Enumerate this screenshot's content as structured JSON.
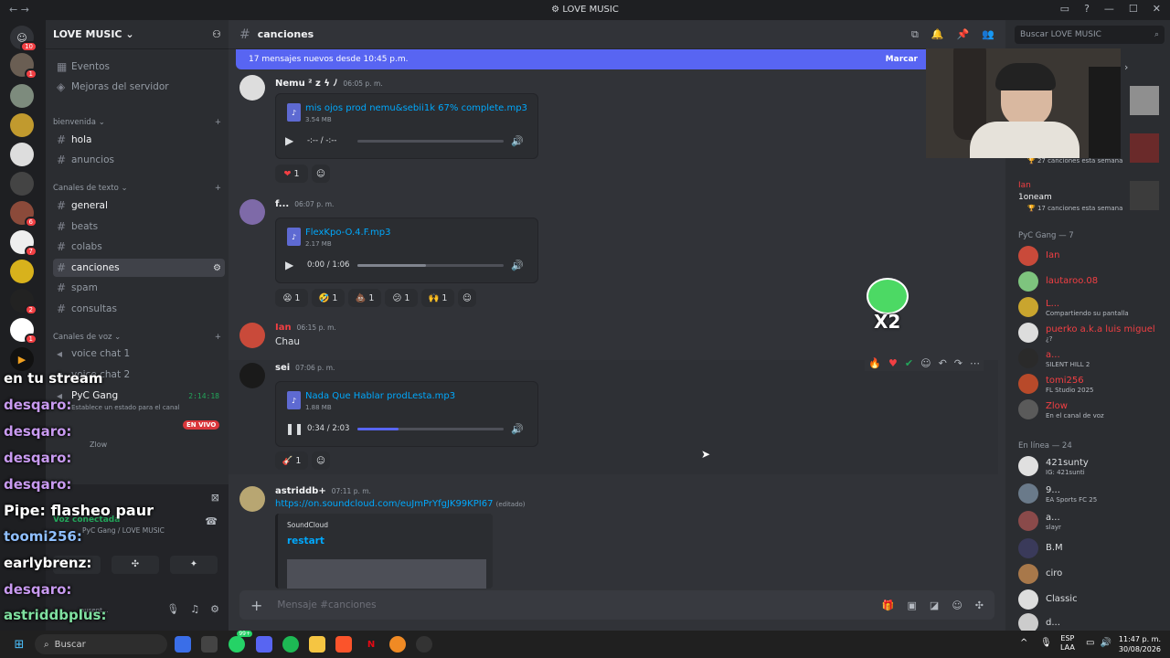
{
  "titlebar": {
    "title": "LOVE MUSIC",
    "nav": "←  →",
    "controls": [
      "▭",
      "?",
      "—",
      "☐",
      "✕"
    ]
  },
  "servers": {
    "home_badge": "10",
    "items": [
      {
        "badge": "1"
      },
      {
        "badge": ""
      },
      {
        "badge": ""
      },
      {
        "badge": ""
      },
      {
        "badge": ""
      },
      {
        "badge": "6"
      },
      {
        "badge": "7"
      },
      {
        "badge": ""
      },
      {
        "badge": "2"
      },
      {
        "badge": "1"
      },
      {
        "badge": ""
      },
      {
        "badge": "1"
      }
    ]
  },
  "guild": {
    "name": "LOVE MUSIC"
  },
  "sidebar": {
    "top_items": [
      "Eventos",
      "Mejoras del servidor"
    ],
    "cat_bienvenida": "bienvenida",
    "ch_hola": "hola",
    "ch_anuncios": "anuncios",
    "cat_text": "Canales de texto",
    "text_channels": [
      "general",
      "beats",
      "colabs",
      "canciones",
      "spam",
      "consultas"
    ],
    "cat_voice": "Canales de voz",
    "voice_channels": [
      "voice chat 1",
      "voice chat 2"
    ],
    "pyc_gang": "PyC Gang",
    "pyc_time": "2:14:18",
    "pyc_status": "Establece un estado para el canal",
    "live_badge": "EN VIVO",
    "zlow": "Zlow",
    "voice_connected": "Voz conectada",
    "voice_location": "PyC Gang / LOVE MUSIC",
    "user_status": "ausent..."
  },
  "overlay_chat": [
    "en tu stream",
    "desqaro:",
    "desqaro:",
    "desqaro:",
    "desqaro:",
    "Pipe: flasheo paur",
    "toomi256:",
    "earlybrenz:",
    "desqaro:",
    "astriddbplus:"
  ],
  "channel": {
    "name": "canciones",
    "search_placeholder": "Buscar LOVE MUSIC"
  },
  "newbar": {
    "text": "17 mensajes nuevos desde 10:45 p.m.",
    "action": "Marcar"
  },
  "messages": [
    {
      "author": "Nemu ² z ϟ ﾉ",
      "time": "06:05 p. m.",
      "file": "mis ojos prod nemu&sebii1k 67% complete.mp3",
      "size": "3.54 MB",
      "player_time": "-:-- / -:--",
      "progress": 0,
      "reactions": [
        {
          "emoji": "❤",
          "count": "1"
        }
      ]
    },
    {
      "author": "f...",
      "time": "06:07 p. m.",
      "file": "FlexKpo-O.4.F.mp3",
      "size": "2.17 MB",
      "player_time": "0:00 / 1:06",
      "progress": 0.47,
      "reactions": [
        {
          "emoji": "😫",
          "count": "1"
        },
        {
          "emoji": "🤣",
          "count": "1"
        },
        {
          "emoji": "💩",
          "count": "1"
        },
        {
          "emoji": "😕",
          "count": "1"
        },
        {
          "emoji": "🙌",
          "count": "1"
        }
      ]
    },
    {
      "author": "Ian",
      "time": "06:15 p. m.",
      "text": "Chau"
    },
    {
      "author": "sei",
      "time": "07:06 p. m.",
      "file": "Nada Que Hablar prodLesta.mp3",
      "size": "1.88 MB",
      "player_time": "0:34 / 2:03",
      "progress": 0.28,
      "reactions": [
        {
          "emoji": "🎸",
          "count": "1"
        }
      ]
    },
    {
      "author": "astriddb+",
      "time": "07:11 p. m.",
      "link": "https://on.soundcloud.com/euJmPrYfgJK99KPI67",
      "edited": "(editado)",
      "embed_provider": "SoundCloud",
      "embed_title": "restart"
    }
  ],
  "composer": {
    "placeholder": "Mensaje #canciones"
  },
  "sticker": {
    "text": "X2"
  },
  "members": {
    "activity_1": "27 canciones esta semana",
    "top_user": "Ian",
    "top_user2": "1oneam",
    "activity_2": "17 canciones esta semana",
    "group1": "PyC Gang — 7",
    "group1_members": [
      {
        "name": "Ian",
        "status": "",
        "color": "#f23f43"
      },
      {
        "name": "lautaroo.08",
        "status": "",
        "color": "#f23f43"
      },
      {
        "name": "L...",
        "status": "Compartiendo su pantalla",
        "color": "#f23f43"
      },
      {
        "name": "puerko a.k.a luis miguel",
        "status": "¿?",
        "color": "#f23f43"
      },
      {
        "name": "a...",
        "status": "SILENT HILL 2",
        "color": "#f23f43"
      },
      {
        "name": "tomi256",
        "status": "FL Studio 2025",
        "color": "#f23f43"
      },
      {
        "name": "Zlow",
        "status": "En el canal de voz",
        "color": "#f23f43"
      }
    ],
    "group2": "En línea — 24",
    "group2_members": [
      {
        "name": "421sunty",
        "status": "IG: 421sunti"
      },
      {
        "name": "9...",
        "status": "EA Sports FC 25"
      },
      {
        "name": "a...",
        "status": "slayr"
      },
      {
        "name": "B.M",
        "status": ""
      },
      {
        "name": "ciro",
        "status": ""
      },
      {
        "name": "Classic",
        "status": ""
      },
      {
        "name": "d...",
        "status": ""
      }
    ]
  },
  "taskbar": {
    "search": "Buscar",
    "lang": "ESP",
    "lang2": "LAA",
    "time": "11:47 p. m.",
    "date": "30/08/2026",
    "badge": "99+"
  }
}
